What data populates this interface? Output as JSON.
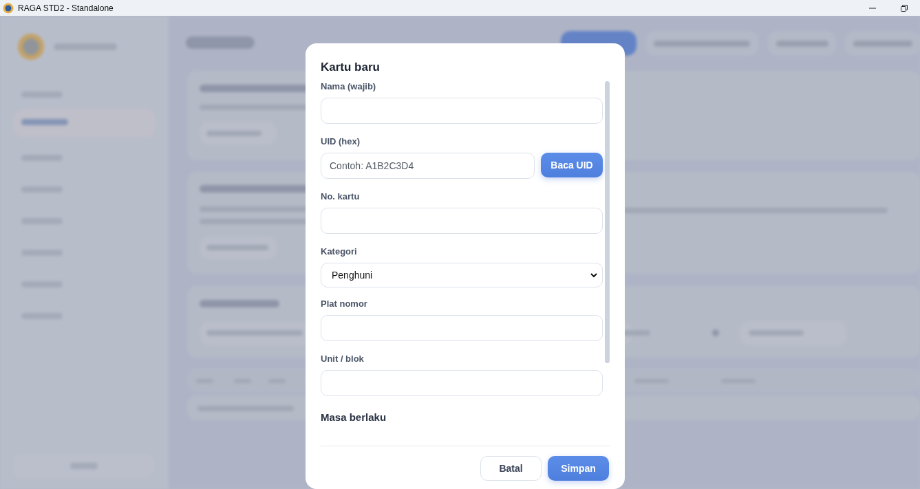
{
  "window": {
    "title": "RAGA STD2 - Standalone"
  },
  "dialog": {
    "title": "Kartu baru",
    "fields": [
      {
        "kind": "text",
        "label": "Nama (wajib)"
      },
      {
        "kind": "text_button",
        "label": "UID (hex)",
        "placeholder": "Contoh: A1B2C3D4",
        "button": "Baca UID"
      },
      {
        "kind": "text",
        "label": "No. kartu"
      },
      {
        "kind": "select",
        "label": "Kategori",
        "value": "Penghuni"
      },
      {
        "kind": "text",
        "label": "Plat nomor"
      },
      {
        "kind": "text",
        "label": "Unit / blok"
      },
      {
        "kind": "heading",
        "label": "Masa berlaku"
      }
    ],
    "buttons": [
      {
        "label": "Batal",
        "primary": false
      },
      {
        "label": "Simpan",
        "primary": true
      }
    ]
  }
}
